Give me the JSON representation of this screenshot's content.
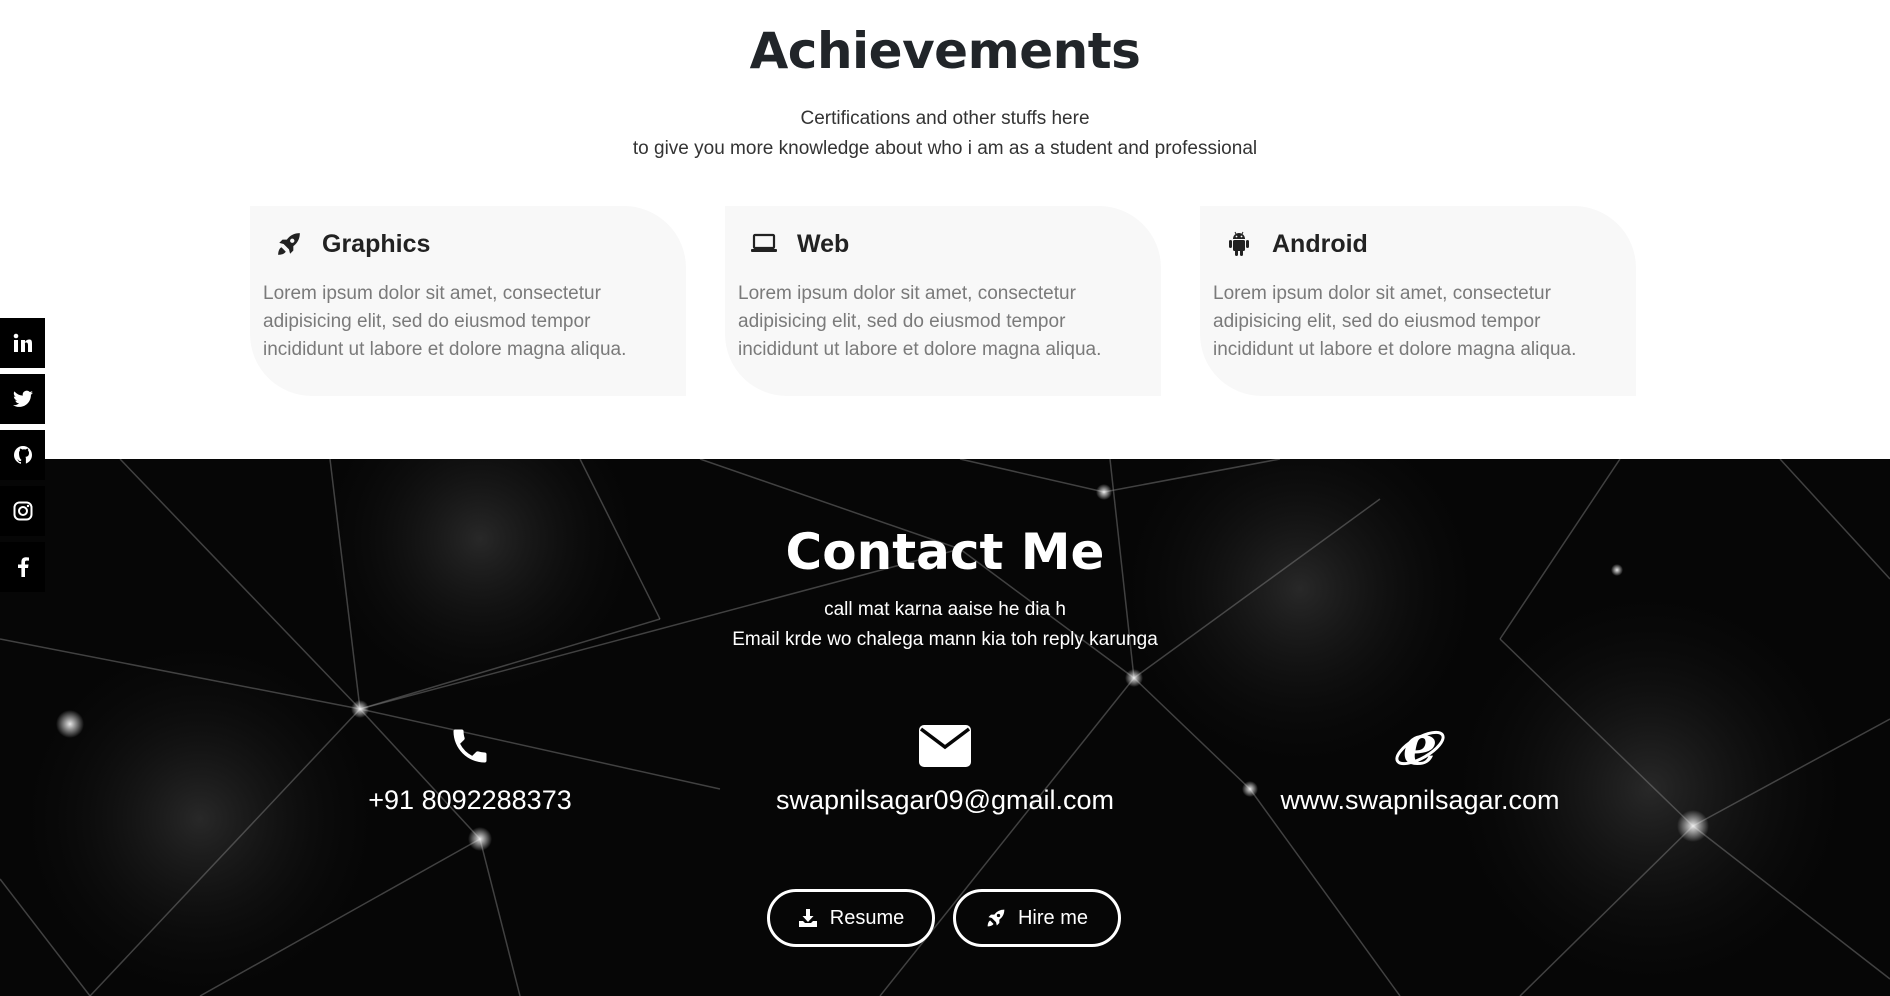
{
  "achievements": {
    "title": "Achievements",
    "subtitle_line1": "Certifications and other stuffs here",
    "subtitle_line2": "to give you more knowledge about who i am as a student and professional",
    "cards": [
      {
        "title": "Graphics",
        "icon": "rocket-icon",
        "text": "Lorem ipsum dolor sit amet, consectetur adipisicing elit, sed do eiusmod tempor incididunt ut labore et dolore magna aliqua."
      },
      {
        "title": "Web",
        "icon": "laptop-icon",
        "text": "Lorem ipsum dolor sit amet, consectetur adipisicing elit, sed do eiusmod tempor incididunt ut labore et dolore magna aliqua."
      },
      {
        "title": "Android",
        "icon": "android-icon",
        "text": "Lorem ipsum dolor sit amet, consectetur adipisicing elit, sed do eiusmod tempor incididunt ut labore et dolore magna aliqua."
      }
    ]
  },
  "social": [
    "linkedin-icon",
    "twitter-icon",
    "github-icon",
    "instagram-icon",
    "facebook-icon"
  ],
  "contact": {
    "title": "Contact Me",
    "subtitle_line1": "call mat karna aaise he dia h",
    "subtitle_line2": "Email krde wo chalega mann kia toh reply karunga",
    "phone": "+91 8092288373",
    "email": "swapnilsagar09@gmail.com",
    "website": "www.swapnilsagar.com",
    "resume_label": "Resume",
    "hire_label": "Hire me"
  },
  "colors": {
    "card_bg": "#f8f8f8",
    "contact_bg": "#060606",
    "social_bg": "#000000",
    "text_muted": "#7a7a7a"
  }
}
